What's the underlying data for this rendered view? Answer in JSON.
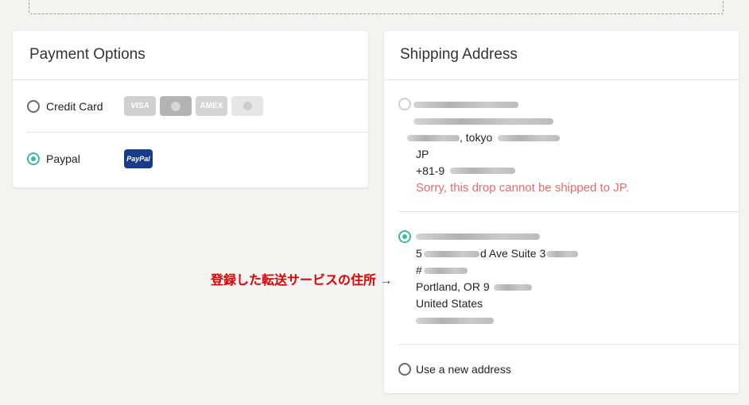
{
  "payment": {
    "title": "Payment Options",
    "options": [
      {
        "label": "Credit Card",
        "selected": false
      },
      {
        "label": "Paypal",
        "selected": true
      }
    ],
    "card_logos": [
      {
        "name": "visa-logo",
        "text": "VISA"
      },
      {
        "name": "mastercard-logo",
        "text": ""
      },
      {
        "name": "amex-logo",
        "text": "AMEX"
      },
      {
        "name": "discover-logo",
        "text": ""
      }
    ],
    "paypal_logo": "PayPal"
  },
  "shipping": {
    "title": "Shipping Address",
    "address1": {
      "city_line": ", tokyo",
      "country": "JP",
      "phone_prefix": "+81-9",
      "error": "Sorry, this drop cannot be shipped to JP.",
      "selected": false
    },
    "address2": {
      "street_prefix": "5",
      "street_suffix": "d Ave Suite 3",
      "unit_prefix": "#",
      "city_line": "Portland, OR 9",
      "country": "United States",
      "selected": true
    },
    "new_address_label": "Use a new address"
  },
  "annotation": "登録した転送サービスの住所 →",
  "colors": {
    "accent": "#3fb6a6",
    "error": "#e86b6b",
    "annotation": "#e00000"
  }
}
